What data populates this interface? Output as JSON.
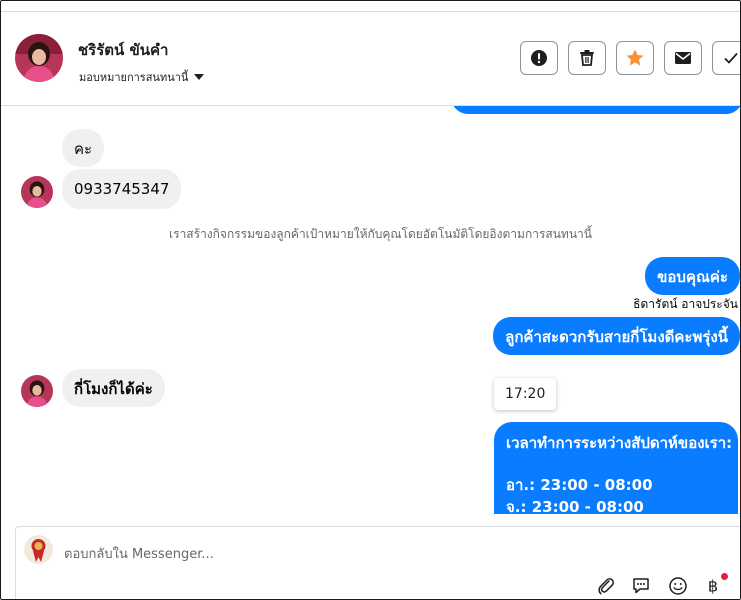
{
  "header": {
    "contact_name": "ชริรัตน์ ขันคำ",
    "assign_label": "มอบหมายการสนทนานี้"
  },
  "messages": {
    "in_1": "คะ",
    "in_2": "0933745347",
    "system_note": "เราสร้างกิจกรรมของลูกค้าเป้าหมายให้กับคุณโดยอัตโนมัติโดยอิงตามการสนทนานี้",
    "out_1": "ขอบคุณค่ะ",
    "out_1_sender": "ธิดารัตน์ อาจประจัน",
    "out_2": "ลูกค้าสะดวกรับสายกี่โมงดีคะพรุ่งนี้",
    "in_3": "กี่โมงก็ได้ค่ะ",
    "time_option": "17:20",
    "hours_title": "เวลาทำการระหว่างสัปดาห์ของเรา:",
    "hours_line_1": "อา.: 23:00 - 08:00",
    "hours_line_2": "จ.: 23:00 - 08:00"
  },
  "composer": {
    "placeholder": "ตอบกลับใน Messenger..."
  },
  "icons": {
    "header_buttons": [
      "alert-icon",
      "trash-icon",
      "star-icon",
      "mail-icon",
      "check-icon"
    ],
    "composer_tools": [
      "paperclip-icon",
      "chat-bubble-icon",
      "emoji-icon",
      "baht-payment-icon"
    ]
  },
  "colors": {
    "outgoing_bubble": "#0a7cff",
    "incoming_bubble": "#f0f0f0",
    "star": "#f7923b",
    "notification_dot": "#e41e3f"
  }
}
